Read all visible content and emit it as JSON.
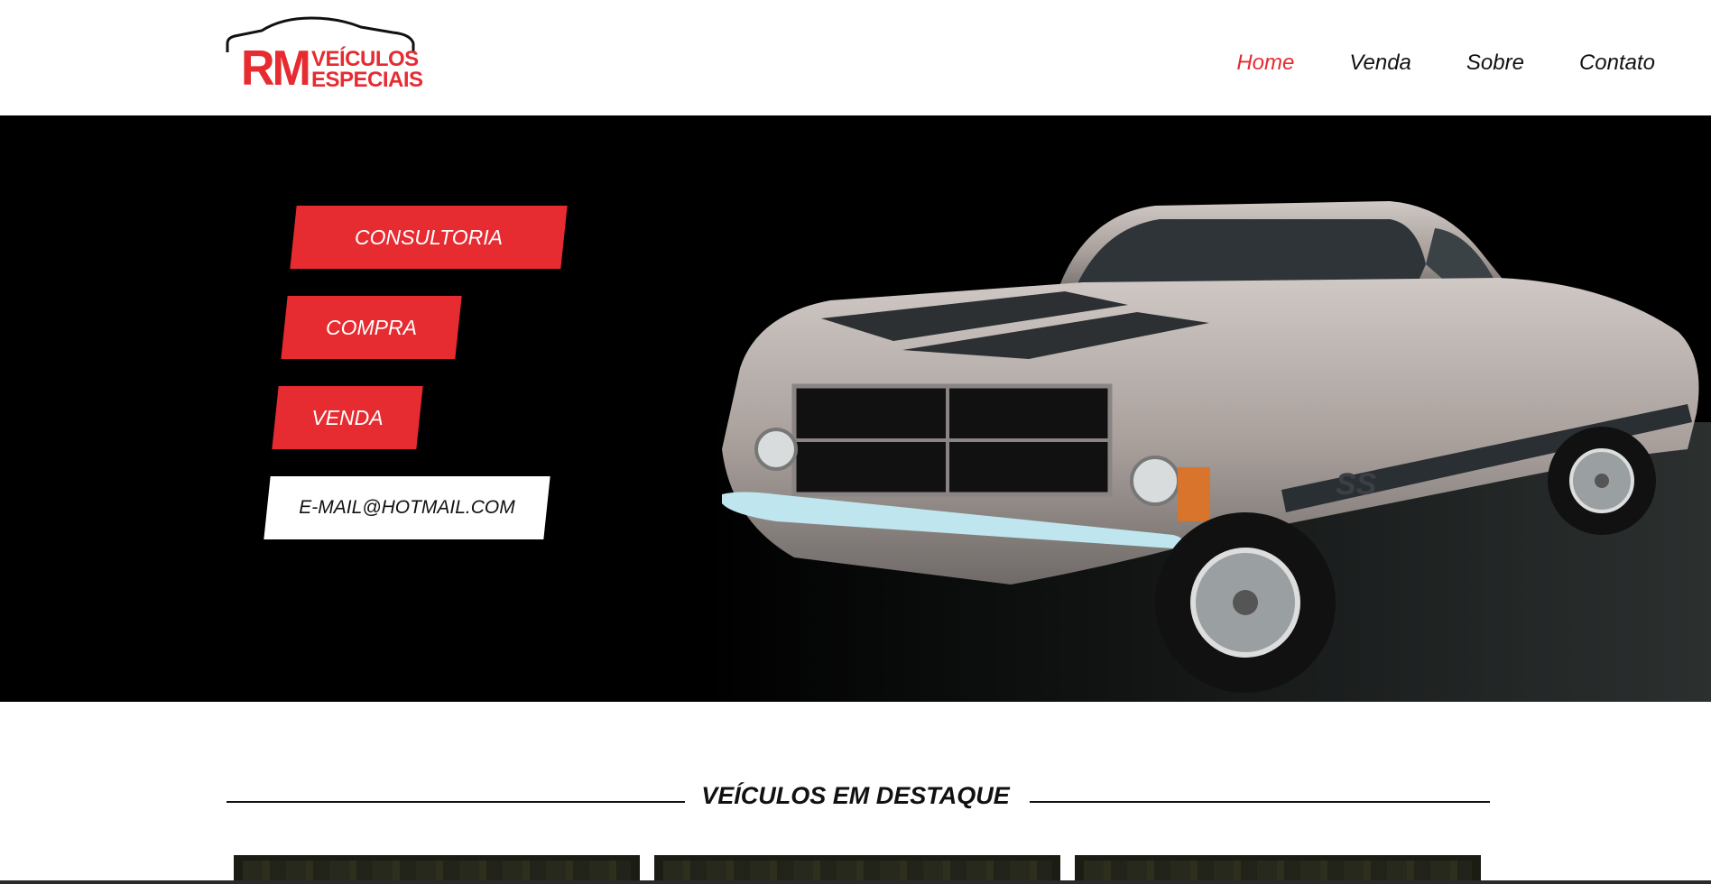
{
  "logo": {
    "initials": "RM",
    "line1": "VEÍCULOS",
    "line2": "ESPECIAIS"
  },
  "nav": [
    {
      "label": "Home",
      "active": true
    },
    {
      "label": "Venda",
      "active": false
    },
    {
      "label": "Sobre",
      "active": false
    },
    {
      "label": "Contato",
      "active": false
    }
  ],
  "hero": {
    "buttons": [
      "CONSULTORIA",
      "COMPRA",
      "VENDA"
    ],
    "email": "E-MAIL@HOTMAIL.COM"
  },
  "featured": {
    "title": "VEÍCULOS EM DESTAQUE"
  },
  "colors": {
    "accent": "#e62b31",
    "text": "#111111",
    "hero_bg": "#000000"
  }
}
